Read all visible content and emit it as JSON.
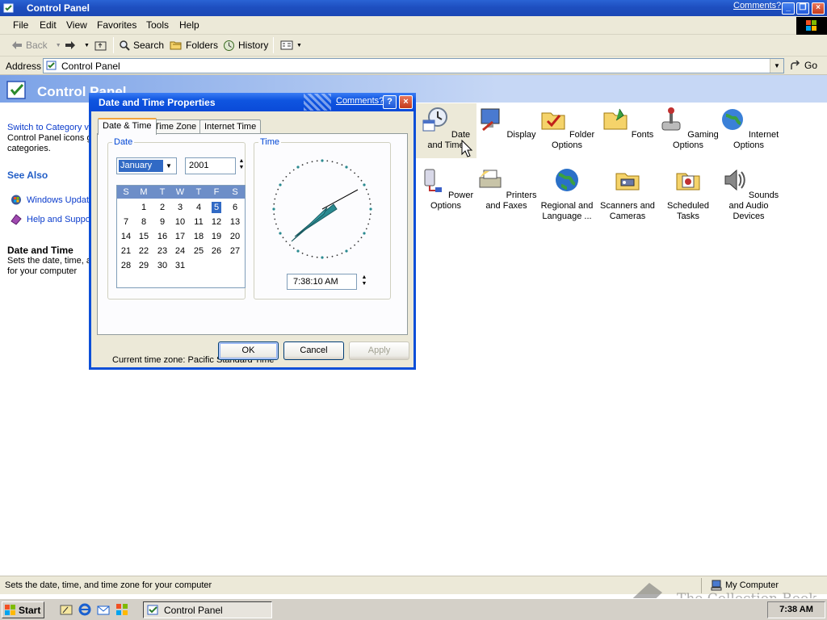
{
  "window": {
    "title": "Control Panel",
    "comments_link": "Comments?",
    "minimize": "_",
    "restore": "❐",
    "close": "×"
  },
  "menu": [
    "File",
    "Edit",
    "View",
    "Favorites",
    "Tools",
    "Help"
  ],
  "toolbar": {
    "back": "Back",
    "search": "Search",
    "folders": "Folders",
    "history": "History"
  },
  "address": {
    "label": "Address",
    "value": "Control Panel",
    "go": "Go"
  },
  "left_pane": {
    "header": "Control Panel",
    "switch_link": "Switch to Category v",
    "desc_line1": "Control Panel icons g",
    "desc_line2": "categories.",
    "see_also": "See Also",
    "see_also_items": [
      "Windows Update",
      "Help and Support"
    ],
    "detail_title": "Date and Time",
    "detail_line1": "Sets the date, time, a",
    "detail_line2": "for your computer"
  },
  "icons": [
    {
      "label": "Date and Time",
      "icon": "clock-icon"
    },
    {
      "label": "Display",
      "icon": "monitor-icon"
    },
    {
      "label": "Folder Options",
      "icon": "folder-check-icon"
    },
    {
      "label": "Fonts",
      "icon": "fonts-folder-icon"
    },
    {
      "label": "Gaming Options",
      "icon": "joystick-icon"
    },
    {
      "label": "Internet Options",
      "icon": "globe-icon"
    },
    {
      "label": "Power Options",
      "icon": "power-icon"
    },
    {
      "label": "Printers and Faxes",
      "icon": "printer-icon"
    },
    {
      "label": "Regional and Language ...",
      "icon": "regional-globe-icon"
    },
    {
      "label": "Scanners and Cameras",
      "icon": "scanner-icon"
    },
    {
      "label": "Scheduled Tasks",
      "icon": "scheduled-tasks-icon"
    },
    {
      "label": "Sounds and Audio Devices",
      "icon": "speaker-icon"
    }
  ],
  "dialog": {
    "title": "Date and Time Properties",
    "comments_link": "Comments?",
    "help": "?",
    "close": "×",
    "tabs": [
      "Date & Time",
      "Time Zone",
      "Internet Time"
    ],
    "date_group": "Date",
    "time_group": "Time",
    "month": "January",
    "year": "2001",
    "weekdays": [
      "S",
      "M",
      "T",
      "W",
      "T",
      "F",
      "S"
    ],
    "weeks": [
      [
        "",
        "1",
        "2",
        "3",
        "4",
        "5",
        "6"
      ],
      [
        "7",
        "8",
        "9",
        "10",
        "11",
        "12",
        "13"
      ],
      [
        "14",
        "15",
        "16",
        "17",
        "18",
        "19",
        "20"
      ],
      [
        "21",
        "22",
        "23",
        "24",
        "25",
        "26",
        "27"
      ],
      [
        "28",
        "29",
        "30",
        "31",
        "",
        "",
        ""
      ]
    ],
    "selected_day": "5",
    "time": "7:38:10 AM",
    "timezone": "Current time zone:  Pacific Standard Time",
    "ok": "OK",
    "cancel": "Cancel",
    "apply": "Apply"
  },
  "status": {
    "text": "Sets the date, time, and time zone for your computer",
    "zone": "My Computer"
  },
  "taskbar": {
    "start": "Start",
    "task": "Control Panel",
    "clock": "7:38 AM"
  },
  "watermark": "The Collection Book",
  "colors": {
    "titlebar": "#1e4fc0",
    "dialog_border": "#0c4fd8",
    "selection": "#316ac5",
    "face": "#ece9d8"
  }
}
